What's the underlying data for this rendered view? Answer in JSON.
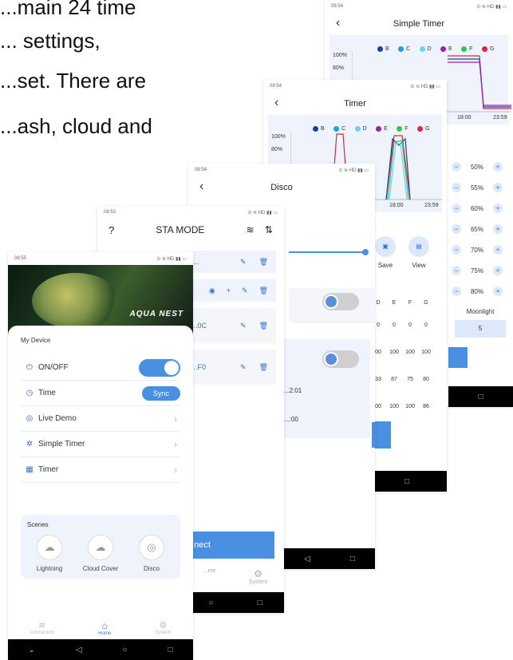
{
  "cover_text": [
    "...main 24 time",
    "... settings,",
    "...set. There are",
    "...ash, cloud and"
  ],
  "status_bar": {
    "time1": "08:55",
    "time2": "08:53",
    "time3": "08:54",
    "icons": "⊙ ≋ HD ▮▮ ▭"
  },
  "home": {
    "mode": "STA MODE",
    "brand": "AQUA NEST",
    "section_title": "My Device",
    "items": [
      {
        "label": "ON/OFF",
        "icon": "⏻"
      },
      {
        "label": "Time",
        "icon": "◷",
        "action": "Sync"
      },
      {
        "label": "Live Demo",
        "icon": "◎"
      },
      {
        "label": "Simple Timer",
        "icon": "✲"
      },
      {
        "label": "Timer",
        "icon": "▦"
      }
    ],
    "scenes_title": "Scenes",
    "scenes": [
      {
        "label": "Lightning"
      },
      {
        "label": "Cloud Cover"
      },
      {
        "label": "Disco"
      }
    ],
    "bottom_nav": [
      {
        "label": "Connection"
      },
      {
        "label": "Home"
      },
      {
        "label": "System"
      }
    ]
  },
  "connection": {
    "items": [
      "...",
      "",
      "...0C",
      "...F0"
    ],
    "connect": "...nect",
    "nav": [
      "...me",
      "System"
    ]
  },
  "disco": {
    "title": "Disco",
    "time_a": "...2:01",
    "time_b": "...:00"
  },
  "timer": {
    "title": "Timer",
    "legend": [
      "B",
      "C",
      "D",
      "E",
      "F",
      "G"
    ],
    "legend_colors": [
      "#1f3da8",
      "#1aa3e8",
      "#63d6f2",
      "#a01fb0",
      "#35c45a",
      "#e0243a"
    ],
    "y_labels": [
      "100%",
      "80%"
    ],
    "x_labels": [
      "18:00",
      "23:59"
    ],
    "save": "Save",
    "view": "View",
    "table_head": [
      "D",
      "E",
      "F",
      "G"
    ],
    "table_rows": [
      [
        "0",
        "0",
        "0",
        "0"
      ],
      [
        "00",
        "100",
        "100",
        "100"
      ],
      [
        "33",
        "87",
        "75",
        "80"
      ],
      [
        "00",
        "100",
        "100",
        "86"
      ]
    ]
  },
  "simple_timer": {
    "title": "Simple Timer",
    "legend": [
      "B",
      "C",
      "D",
      "E",
      "F",
      "G"
    ],
    "y_labels": [
      "100%",
      "80%"
    ],
    "x_labels": [
      "18:00",
      "23:59"
    ],
    "steps": [
      "50%",
      "55%",
      "60%",
      "65%",
      "70%",
      "75%",
      "80%"
    ],
    "moonlight_label": "Moonlight",
    "moonlight_value": "5"
  }
}
